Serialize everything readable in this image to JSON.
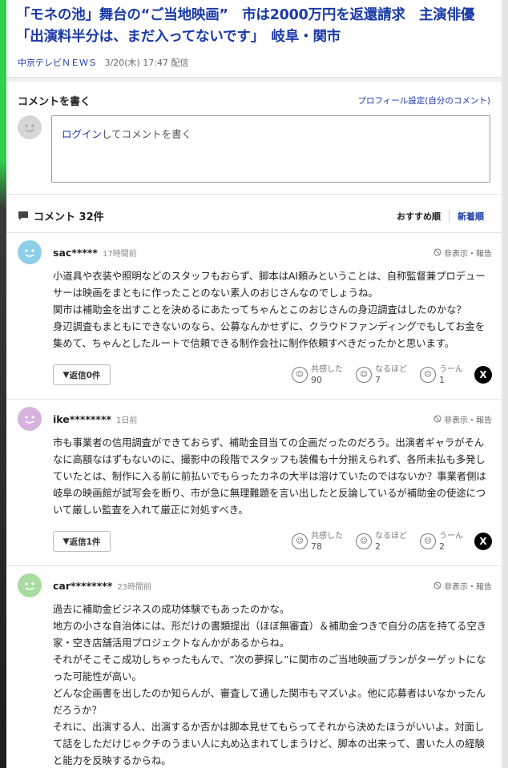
{
  "article": {
    "headline_line1": "「モネの池」舞台の“ご当地映画”　市は2000万円を返還請求　主演俳優",
    "headline_line2": "「出演料半分は、まだ入ってないです」　岐阜・関市",
    "source": "中京テレビＮＥＷＳ",
    "date": "3/20(木) 17:47 配信"
  },
  "compose": {
    "title": "コメントを書く",
    "profile_link": "プロフィール設定(自分のコメント)",
    "login_text": "ログイン",
    "placeholder_rest": "してコメントを書く"
  },
  "comments_header": {
    "title": "コメント 32件",
    "sort_recommended": "おすすめ順",
    "sort_newest": "新着順"
  },
  "comments": [
    {
      "user": "sac*****",
      "time": "17時間前",
      "report": "非表示・報告",
      "text": "小道具や衣装や照明などのスタッフもおらず、脚本はAI頼みということは、自称監督兼プロデューサーは映画をまともに作ったことのない素人のおじさんなのでしょうね。\n関市は補助金を出すことを決めるにあたってちゃんとこのおじさんの身辺調査はしたのかな？\n身辺調査もまともにできないのなら、公募なんかせずに、クラウドファンディングでもしてお金を集めて、ちゃんとしたルートで信頼できる制作会社に制作依頼すべきだったかと思います。",
      "reply": "返信0件",
      "agree_label": "共感した",
      "agree": "90",
      "naruhodo_label": "なるほど",
      "naruhodo": "7",
      "uun_label": "うーん",
      "uun": "1",
      "avatar_color": "#8ecfe8"
    },
    {
      "user": "ike********",
      "time": "1日前",
      "report": "非表示・報告",
      "text": "市も事業者の信用調査ができておらず、補助金目当ての企画だったのだろう。出演者ギャラがそんなに高額なはずもないのに、撮影中の段階でスタッフも装備も十分揃えられず、各所未払も多発していたとは、制作に入る前に前払いでもらったカネの大半は溶けていたのではないか？事業者側は岐阜の映画館が試写会を断り、市が急に無理難題を言い出したと反論しているが補助金の使途について厳しい監査を入れて厳正に対処すべき。",
      "reply": "返信1件",
      "agree_label": "共感した",
      "agree": "78",
      "naruhodo_label": "なるほど",
      "naruhodo": "2",
      "uun_label": "うーん",
      "uun": "2",
      "avatar_color": "#d9b3e0"
    },
    {
      "user": "car********",
      "time": "23時間前",
      "report": "非表示・報告",
      "text": "過去に補助金ビジネスの成功体験でもあったのかな。\n地方の小さな自治体には、形だけの書類提出（ほぼ無審査）＆補助金つきで自分の店を持てる空き家・空き店舗活用プロジェクトなんかがあるからね。\nそれがそこそこ成功しちゃったもんで、“次の夢探し”に関市のご当地映画プランがターゲットになった可能性が高い。\nどんな企画書を出したのか知らんが、審査して通した関市もマズいよ。他に応募者はいなかったんだろうか？\nそれに、出演する人、出演するか否かは脚本見せてもらってそれから決めたほうがいいよ。対面して話をしただけじゃクチのうまい人に丸め込まれてしまうけど、脚本の出来って、書いた人の経験と能力を反映するからね。\n薄っぺらい脚本は、それを書いた人の経験と能力も薄っぺらいってこと。",
      "avatar_color": "#a8dca0"
    }
  ],
  "colors": {
    "link": "#1a3aa8",
    "accent_green": "#2fd24a"
  }
}
